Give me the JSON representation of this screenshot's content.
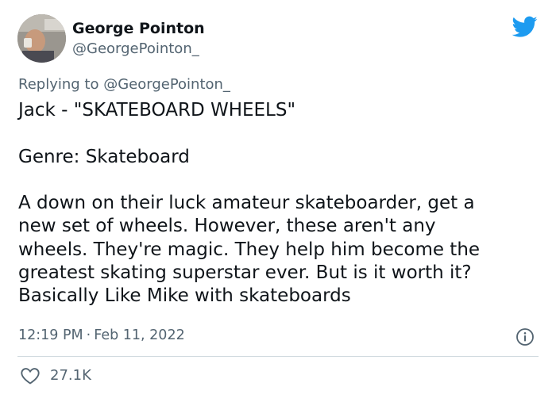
{
  "author": {
    "display_name": "George Pointon",
    "handle": "@GeorgePointon_",
    "avatar_icon": "profile-photo"
  },
  "reply": {
    "prefix": "Replying to ",
    "mention": "@GeorgePointon_"
  },
  "tweet": {
    "text": "Jack - \"SKATEBOARD WHEELS\"\n\nGenre: Skateboard\n\nA down on their luck amateur skateboarder, get a\nnew set of wheels. However, these aren't any\nwheels. They're magic. They help him become the\ngreatest skating superstar ever. But is it worth it?\nBasically Like Mike with skateboards"
  },
  "meta": {
    "time": "12:19 PM",
    "separator": "·",
    "date": "Feb 11, 2022"
  },
  "engagement": {
    "likes": "27.1K"
  },
  "colors": {
    "twitter_blue": "#1d9bf0",
    "secondary_text": "#536471",
    "primary_text": "#0f1419"
  },
  "icons": {
    "brand": "twitter-bird-icon",
    "info": "info-icon",
    "like": "heart-icon"
  }
}
